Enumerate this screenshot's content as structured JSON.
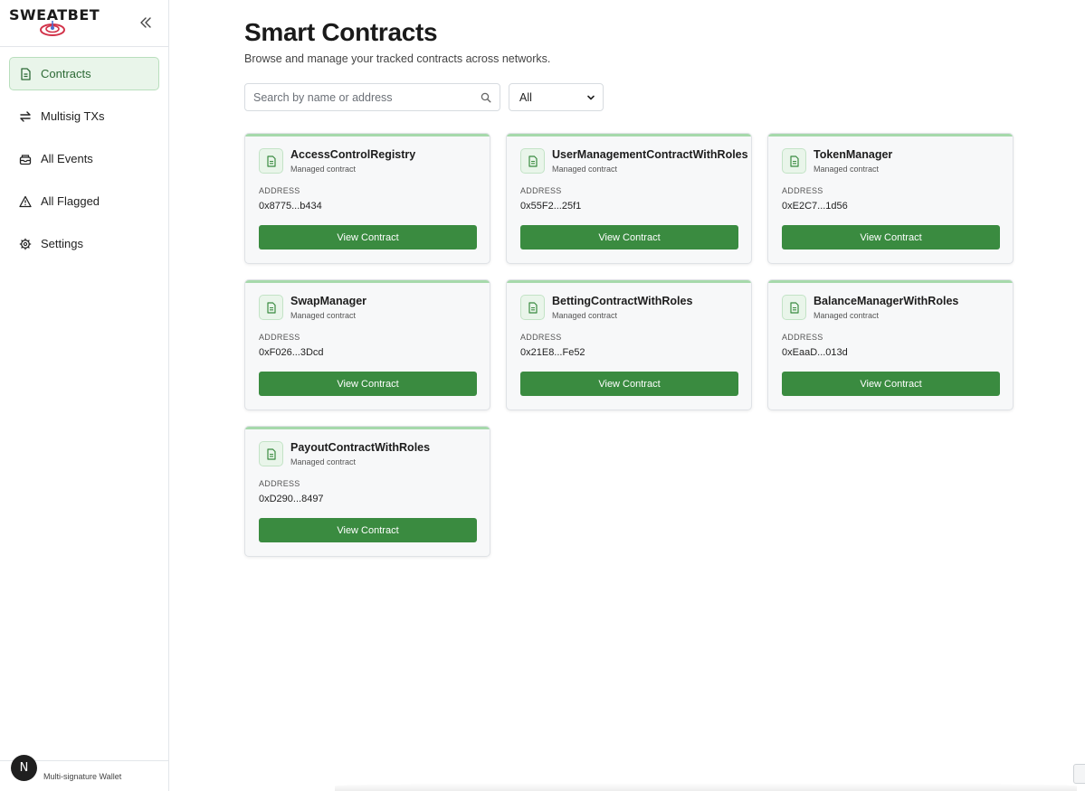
{
  "brand": {
    "name": "SWEATBET",
    "colors": {
      "accent": "#3a8b40",
      "accent_light": "#e9f5ea",
      "logo_red": "#d2334a"
    }
  },
  "sidebar": {
    "collapse_icon": "double-chevron-left-icon",
    "items": [
      {
        "label": "Contracts",
        "icon": "document-icon",
        "active": true
      },
      {
        "label": "Multisig TXs",
        "icon": "swap-arrows-icon",
        "active": false
      },
      {
        "label": "All Events",
        "icon": "inbox-icon",
        "active": false
      },
      {
        "label": "All Flagged",
        "icon": "warning-icon",
        "active": false
      },
      {
        "label": "Settings",
        "icon": "gear-icon",
        "active": false
      }
    ],
    "footer": {
      "avatar_initial": "N",
      "wallet_label": "Multi-signature Wallet"
    }
  },
  "header": {
    "title": "Smart Contracts",
    "subtitle": "Browse and manage your tracked contracts across networks."
  },
  "filters": {
    "search_placeholder": "Search by name or address",
    "search_value": "",
    "network_selected": "All"
  },
  "contracts": [
    {
      "name": "AccessControlRegistry",
      "subtitle": "Managed contract",
      "address_label": "ADDRESS",
      "address": "0x8775...b434",
      "button": "View Contract"
    },
    {
      "name": "UserManagementContractWithRoles",
      "subtitle": "Managed contract",
      "address_label": "ADDRESS",
      "address": "0x55F2...25f1",
      "button": "View Contract"
    },
    {
      "name": "TokenManager",
      "subtitle": "Managed contract",
      "address_label": "ADDRESS",
      "address": "0xE2C7...1d56",
      "button": "View Contract"
    },
    {
      "name": "SwapManager",
      "subtitle": "Managed contract",
      "address_label": "ADDRESS",
      "address": "0xF026...3Dcd",
      "button": "View Contract"
    },
    {
      "name": "BettingContractWithRoles",
      "subtitle": "Managed contract",
      "address_label": "ADDRESS",
      "address": "0x21E8...Fe52",
      "button": "View Contract"
    },
    {
      "name": "BalanceManagerWithRoles",
      "subtitle": "Managed contract",
      "address_label": "ADDRESS",
      "address": "0xEaaD...013d",
      "button": "View Contract"
    },
    {
      "name": "PayoutContractWithRoles",
      "subtitle": "Managed contract",
      "address_label": "ADDRESS",
      "address": "0xD290...8497",
      "button": "View Contract"
    }
  ]
}
